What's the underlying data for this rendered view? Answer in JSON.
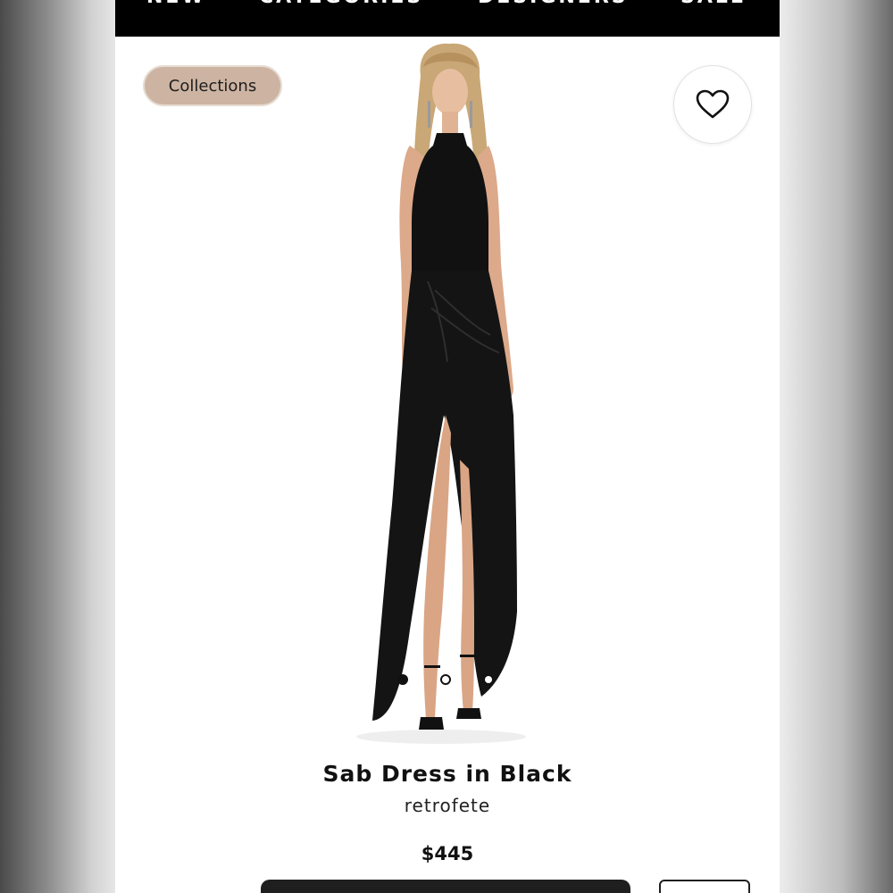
{
  "nav": {
    "items": [
      "NEW",
      "CATEGORIES",
      "DESIGNERS",
      "SALE"
    ]
  },
  "collections_label": "Collections",
  "product": {
    "title": "Sab Dress in Black",
    "brand": "retrofete",
    "price": "$445"
  },
  "carousel": {
    "total": 3,
    "active_index": 0
  },
  "icons": {
    "favorite": "heart-outline-icon"
  },
  "colors": {
    "nav_bg": "#000000",
    "pill_bg": "#cdb4a2",
    "button_dark": "#1f1f1f"
  }
}
